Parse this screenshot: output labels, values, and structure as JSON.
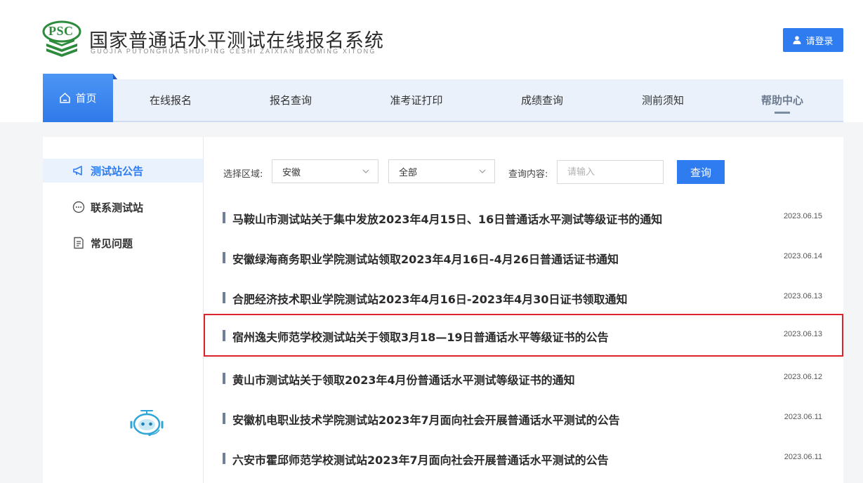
{
  "brand": {
    "logo_text": "PSC",
    "title": "国家普通话水平测试在线报名系统",
    "subtitle": "GUOJIA PUTONGHUA SHUIPING CESHI ZAIXIAN BAOMING XITONG"
  },
  "header": {
    "login_label": "请登录"
  },
  "nav": {
    "home": "首页",
    "items": [
      "在线报名",
      "报名查询",
      "准考证打印",
      "成绩查询",
      "测前须知",
      "帮助中心"
    ]
  },
  "sidebar": {
    "items": [
      "测试站公告",
      "联系测试站",
      "常见问题"
    ]
  },
  "filter": {
    "region_label": "选择区域:",
    "region_value": "安徽",
    "sub_value": "全部",
    "query_label": "查询内容:",
    "query_placeholder": "请输入",
    "search_label": "查询"
  },
  "notices": [
    {
      "title": "马鞍山市测试站关于集中发放2023年4月15日、16日普通话水平测试等级证书的通知",
      "date": "2023.06.15"
    },
    {
      "title": "安徽绿海商务职业学院测试站领取2023年4月16日-4月26日普通话证书通知",
      "date": "2023.06.14"
    },
    {
      "title": "合肥经济技术职业学院测试站2023年4月16日-2023年4月30日证书领取通知",
      "date": "2023.06.13"
    },
    {
      "title": "宿州逸夫师范学校测试站关于领取3月18—19日普通话水平等级证书的公告",
      "date": "2023.06.13"
    },
    {
      "title": "黄山市测试站关于领取2023年4月份普通话水平测试等级证书的通知",
      "date": "2023.06.12"
    },
    {
      "title": "安徽机电职业技术学院测试站2023年7月面向社会开展普通话水平测试的公告",
      "date": "2023.06.11"
    },
    {
      "title": "六安市霍邱师范学校测试站2023年7月面向社会开展普通话水平测试的公告",
      "date": "2023.06.11"
    }
  ],
  "colors": {
    "accent": "#2f7cf0",
    "highlight_border": "#d9252b",
    "logo_green": "#2e8b3d"
  }
}
